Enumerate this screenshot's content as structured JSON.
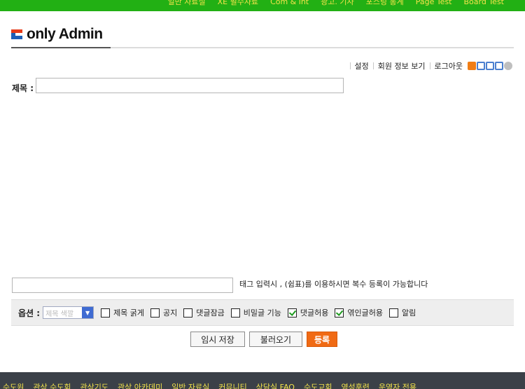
{
  "top_nav": [
    "일반 자료실",
    "XE 필수자료",
    "Com & int",
    "광고. 기사",
    "포스팅 통계",
    "Page Test",
    "Board Test"
  ],
  "logo": {
    "text": "only Admin"
  },
  "account": {
    "settings": "설정",
    "member_info": "회원 정보 보기",
    "logout": "로그아웃"
  },
  "form": {
    "title_label": "제목 :",
    "title_value": "",
    "tag_value": "",
    "tag_help": "태그 입력시 , (쉼표)를 이용하시면 복수 등록이 가능합니다",
    "options_label": "옵션 :",
    "title_color_placeholder": "제목 색깔",
    "checkboxes": [
      {
        "label": "제목 굵게",
        "checked": false
      },
      {
        "label": "공지",
        "checked": false
      },
      {
        "label": "댓글잠금",
        "checked": false
      },
      {
        "label": "비밀글 기능",
        "checked": false
      },
      {
        "label": "댓글허용",
        "checked": true
      },
      {
        "label": "엮인글허용",
        "checked": true
      },
      {
        "label": "알림",
        "checked": false
      }
    ],
    "buttons": {
      "temp_save": "임시 저장",
      "load": "불러오기",
      "submit": "등록"
    }
  },
  "footer_nav": [
    "수도원",
    "관상 수도회",
    "관상기도",
    "관상 아카데미",
    "일반 자료실",
    "커뮤니티",
    "상담실 FAQ",
    "수도교회",
    "영성훈련",
    "운영자 전용"
  ],
  "colors": {
    "top_nav_bg": "#22b014",
    "nav_text": "#f2e24a",
    "footer_bg": "#3b4048",
    "submit_bg": "#f06a14"
  }
}
